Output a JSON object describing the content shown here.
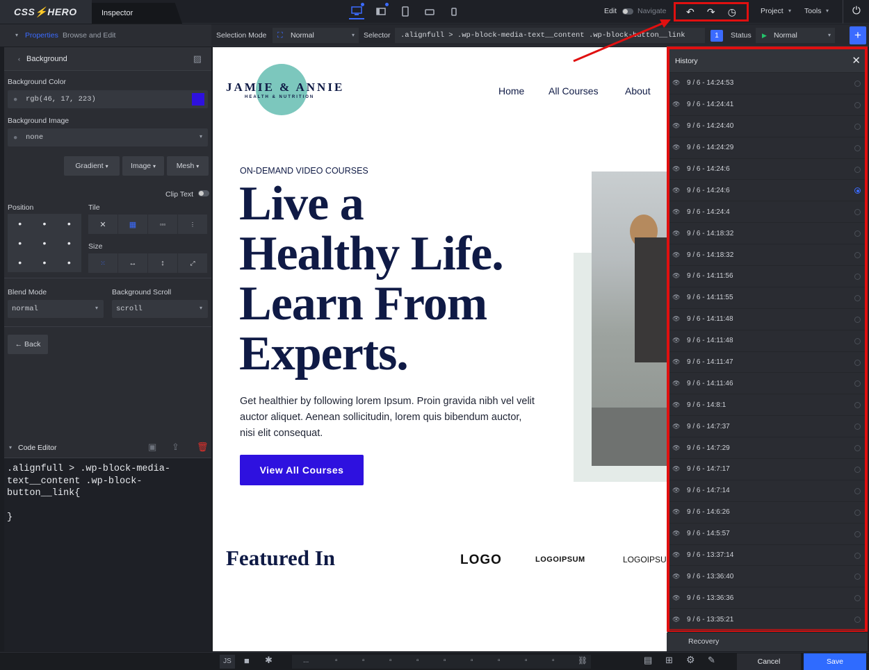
{
  "topbar": {
    "logo": "CSS⚡HERO",
    "inspector_tab": "Inspector",
    "edit_label": "Edit",
    "navigate_label": "Navigate",
    "project_label": "Project",
    "tools_label": "Tools"
  },
  "bar2": {
    "properties_label": "Properties",
    "browse_label": "Browse and Edit",
    "selection_mode_label": "Selection Mode",
    "selection_mode_value": "Normal",
    "selector_label": "Selector",
    "selector_value": ".alignfull > .wp-block-media-text__content .wp-block-button__link",
    "selector_count": "1",
    "status_label": "Status",
    "status_value": "Normal"
  },
  "left": {
    "section_title": "Background",
    "bg_color_label": "Background Color",
    "bg_color_value": "rgb(46, 17, 223)",
    "bg_color_swatch": "#2e11df",
    "bg_image_label": "Background Image",
    "bg_image_value": "none",
    "gradient_btn": "Gradient",
    "image_btn": "Image",
    "mesh_btn": "Mesh",
    "clip_text_label": "Clip Text",
    "position_label": "Position",
    "tile_label": "Tile",
    "size_label": "Size",
    "blend_mode_label": "Blend Mode",
    "blend_mode_value": "normal",
    "bg_scroll_label": "Background Scroll",
    "bg_scroll_value": "scroll",
    "back_btn": "← Back"
  },
  "code_editor": {
    "title": "Code Editor",
    "line1": ".alignfull > .wp-block-media-",
    "line2": "text__content .wp-block-",
    "line3": "button__link{",
    "line4": "}"
  },
  "site": {
    "brand_name": "JAMIE & ANNIE",
    "brand_tagline": "HEALTH & NUTRITION",
    "nav": [
      "Home",
      "All Courses",
      "About"
    ],
    "eyebrow": "ON-DEMAND VIDEO COURSES",
    "hero_line1": "Live a",
    "hero_line2": "Healthy Life.",
    "hero_line3": "Learn From",
    "hero_line4": "Experts.",
    "hero_body": "Get healthier by following lorem Ipsum. Proin gravida nibh vel velit auctor aliquet. Aenean sollicitudin, lorem quis bibendum auctor, nisi elit consequat.",
    "cta": "View All Courses",
    "featured": "Featured In",
    "logo1": "LOGO",
    "logo2": "LOGOIPSUM",
    "logo3": "LOGOIPSU",
    "cta_color": "#2e11df"
  },
  "history": {
    "title": "History",
    "items": [
      "9 / 6 - 14:24:53",
      "9 / 6 - 14:24:41",
      "9 / 6 - 14:24:40",
      "9 / 6 - 14:24:29",
      "9 / 6 - 14:24:6",
      "9 / 6 - 14:24:6",
      "9 / 6 - 14:24:4",
      "9 / 6 - 14:18:32",
      "9 / 6 - 14:18:32",
      "9 / 6 - 14:11:56",
      "9 / 6 - 14:11:55",
      "9 / 6 - 14:11:48",
      "9 / 6 - 14:11:48",
      "9 / 6 - 14:11:47",
      "9 / 6 - 14:11:46",
      "9 / 6 - 14:8:1",
      "9 / 6 - 14:7:37",
      "9 / 6 - 14:7:29",
      "9 / 6 - 14:7:17",
      "9 / 6 - 14:7:14",
      "9 / 6 - 14:6:26",
      "9 / 6 - 14:5:57",
      "9 / 6 - 13:37:14",
      "9 / 6 - 13:36:40",
      "9 / 6 - 13:36:36",
      "9 / 6 - 13:35:21"
    ],
    "active_index": 5,
    "recovery_label": "Recovery"
  },
  "bottom": {
    "js_label": "JS",
    "ellipsis": "...",
    "cancel_btn": "Cancel",
    "save_btn": "Save"
  }
}
